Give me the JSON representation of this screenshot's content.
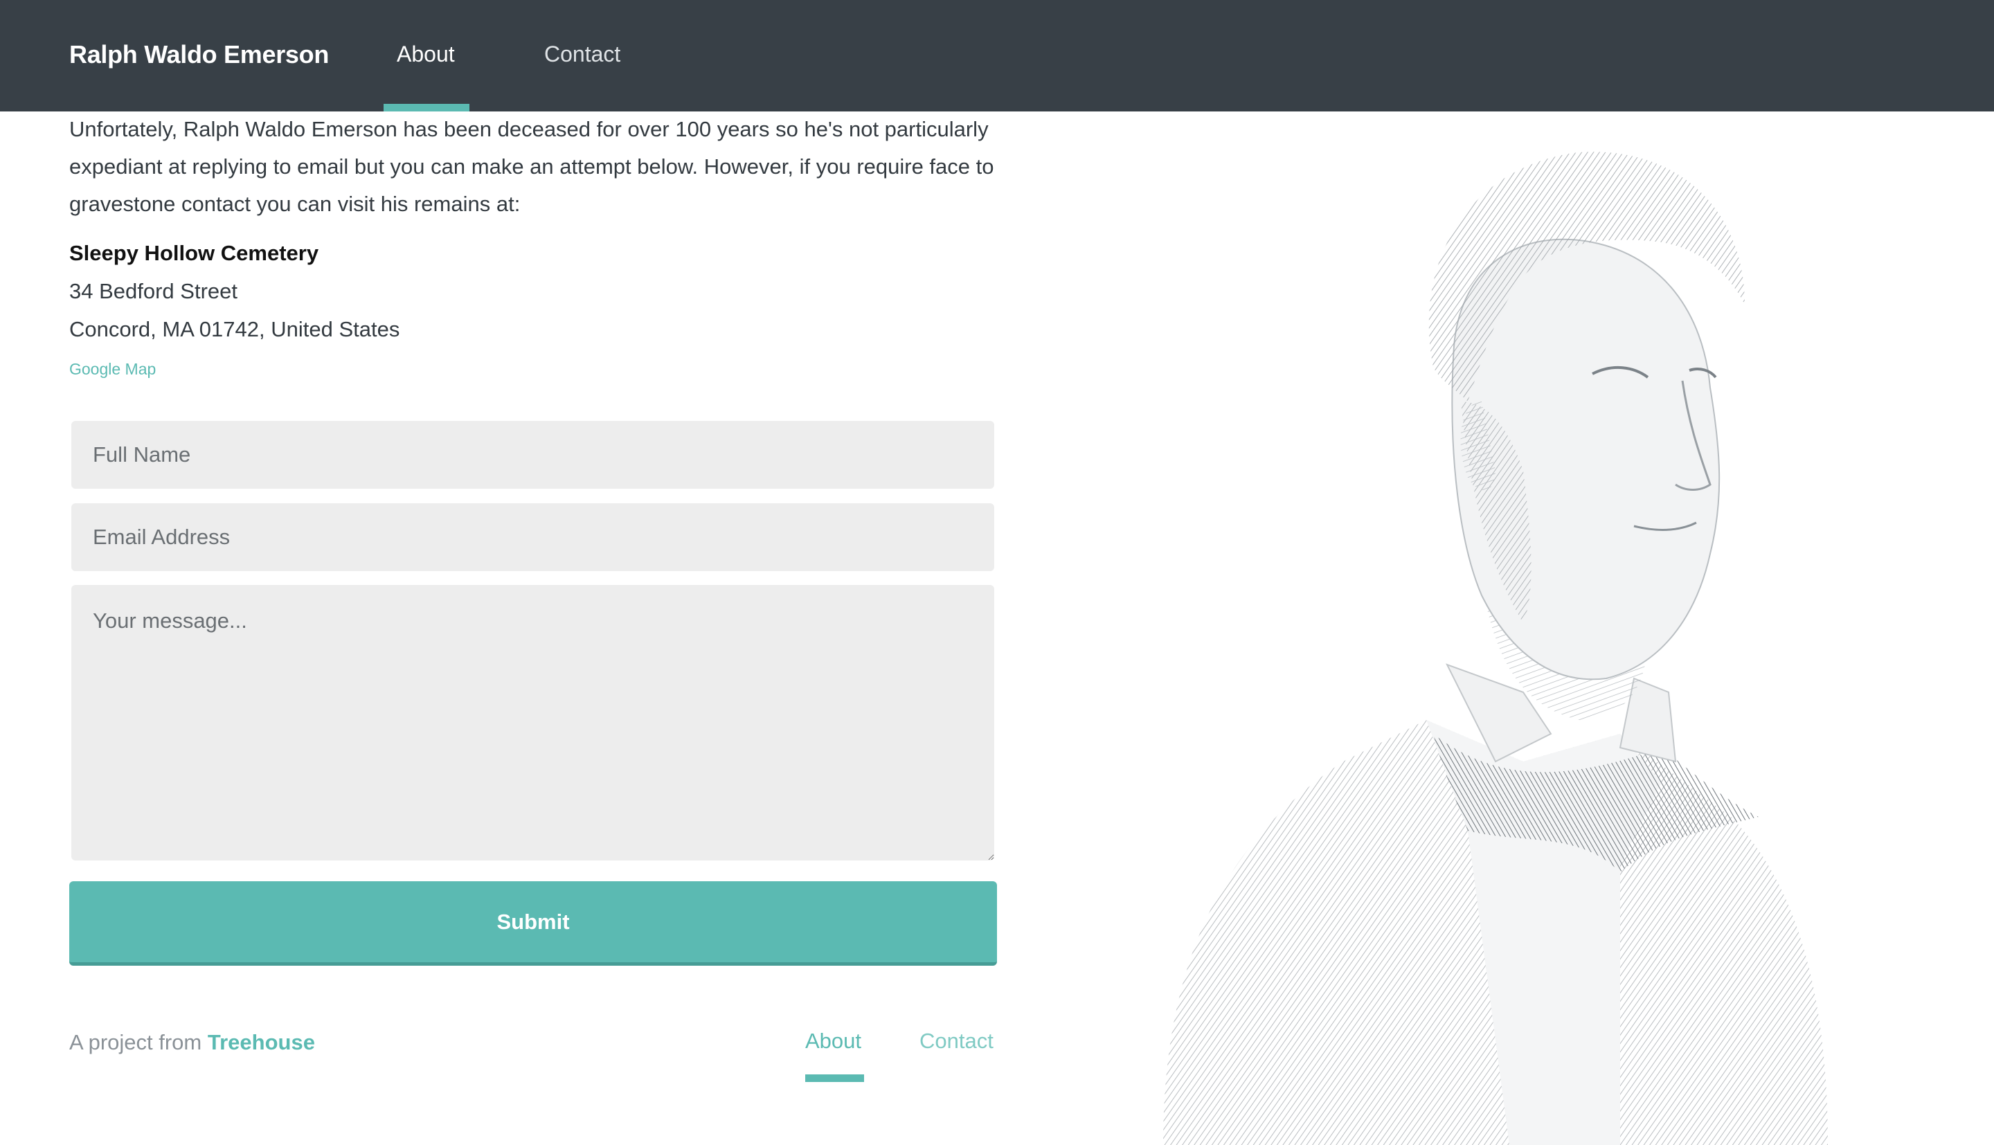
{
  "header": {
    "brand": "Ralph Waldo Emerson",
    "nav": {
      "about": "About",
      "contact": "Contact"
    },
    "active": "About"
  },
  "intro": {
    "text": "Unfortately, Ralph Waldo Emerson has been deceased for over 100 years so he's not particularly expediant at replying to email but you can make an attempt below. However, if you require face to gravestone contact you can visit his remains at:"
  },
  "address": {
    "name": "Sleepy Hollow Cemetery",
    "line1": "34 Bedford Street",
    "line2": "Concord, MA 01742, United States",
    "map_link": "Google Map"
  },
  "form": {
    "name_placeholder": "Full Name",
    "email_placeholder": "Email Address",
    "message_placeholder": "Your message...",
    "submit_label": "Submit"
  },
  "footer": {
    "credit_prefix": "A project from",
    "credit_link": "Treehouse",
    "nav": {
      "about": "About",
      "contact": "Contact"
    }
  },
  "colors": {
    "header_bg": "#384047",
    "accent": "#5bbab2",
    "field_bg": "#ededed"
  }
}
